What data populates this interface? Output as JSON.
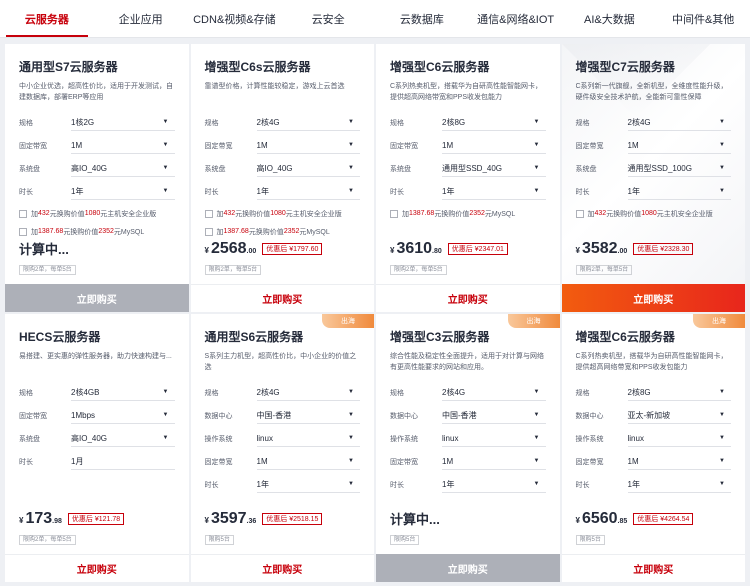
{
  "tabs": [
    {
      "label": "云服务器",
      "active": true
    },
    {
      "label": "企业应用"
    },
    {
      "label": "CDN&视频&存储"
    },
    {
      "label": "云安全"
    },
    {
      "label": "云数据库"
    },
    {
      "label": "通信&网络&IOT"
    },
    {
      "label": "AI&大数据"
    },
    {
      "label": "中间件&其他"
    }
  ],
  "buy_label": "立即购买",
  "colors": {
    "brand": "#c7000b",
    "overseas_tag": "#f08a3c"
  },
  "cards": [
    {
      "title": "通用型S7云服务器",
      "desc": "中小企业优选，超高性价比，适用于开发测试，自建数据库，部署ERP等应用",
      "specs": [
        {
          "label": "规格",
          "value": "1核2G"
        },
        {
          "label": "固定带宽",
          "value": "1M"
        },
        {
          "label": "系统盘",
          "value": "高IO_40G"
        },
        {
          "label": "时长",
          "value": "1年"
        }
      ],
      "options": [
        {
          "pre": "加",
          "a": "432",
          "mid": "元换购价值",
          "b": "1080",
          "post": "元主机安全企业版"
        },
        {
          "pre": "加",
          "a": "1387.68",
          "mid": "元换购价值",
          "b": "2352",
          "post": "元MySQL"
        }
      ],
      "calculating": "计算中...",
      "limit": "限购2单，每单5台",
      "buy_style": "gray"
    },
    {
      "title": "增强型C6s云服务器",
      "desc": "靠谱型价格，计算性能较稳定，游戏上云首选",
      "specs": [
        {
          "label": "规格",
          "value": "2核4G"
        },
        {
          "label": "固定带宽",
          "value": "1M"
        },
        {
          "label": "系统盘",
          "value": "高IO_40G"
        },
        {
          "label": "时长",
          "value": "1年"
        }
      ],
      "options": [
        {
          "pre": "加",
          "a": "432",
          "mid": "元换购价值",
          "b": "1080",
          "post": "元主机安全企业版"
        },
        {
          "pre": "加",
          "a": "1387.68",
          "mid": "元换购价值",
          "b": "2352",
          "post": "元MySQL"
        }
      ],
      "currency": "¥",
      "price_int": "2568",
      "price_dec": ".00",
      "discount": "优惠后 ¥1797.60",
      "limit": "限购2单，每单5台",
      "buy_style": "normal"
    },
    {
      "title": "增强型C6云服务器",
      "desc": "C系列热卖机型，搭载华为自研高性能智能网卡，提供超高网络带宽和PPS收发包能力",
      "specs": [
        {
          "label": "规格",
          "value": "2核8G"
        },
        {
          "label": "固定带宽",
          "value": "1M"
        },
        {
          "label": "系统盘",
          "value": "通用型SSD_40G"
        },
        {
          "label": "时长",
          "value": "1年"
        }
      ],
      "options": [
        {
          "pre": "加",
          "a": "1387.68",
          "mid": "元换购价值",
          "b": "2352",
          "post": "元MySQL"
        }
      ],
      "currency": "¥",
      "price_int": "3610",
      "price_dec": ".80",
      "discount": "优惠后 ¥2347.01",
      "limit": "限购2单，每单5台",
      "buy_style": "normal"
    },
    {
      "title": "增强型C7云服务器",
      "desc": "C系列新一代旗舰，全新机型，全维度性能升级，硬件级安全技术护航，全能新可靠性保障",
      "specs": [
        {
          "label": "规格",
          "value": "2核4G"
        },
        {
          "label": "固定带宽",
          "value": "1M"
        },
        {
          "label": "系统盘",
          "value": "通用型SSD_100G"
        },
        {
          "label": "时长",
          "value": "1年"
        }
      ],
      "options": [
        {
          "pre": "加",
          "a": "432",
          "mid": "元换购价值",
          "b": "1080",
          "post": "元主机安全企业版"
        }
      ],
      "currency": "¥",
      "price_int": "3582",
      "price_dec": ".00",
      "discount": "优惠后 ¥2328.30",
      "limit": "限购2单，每单5台",
      "buy_style": "red",
      "deco": true
    },
    {
      "title": "HECS云服务器",
      "desc": "易搭建、更实惠的弹性服务器，助力快速构建与...",
      "specs": [
        {
          "label": "规格",
          "value": "2核4GB"
        },
        {
          "label": "固定带宽",
          "value": "1Mbps"
        },
        {
          "label": "系统盘",
          "value": "高IO_40G"
        },
        {
          "label": "时长",
          "value": "1月",
          "nocaret": true
        }
      ],
      "options": [],
      "currency": "¥",
      "price_int": "173",
      "price_dec": ".98",
      "discount": "优惠后 ¥121.78",
      "limit": "限购2单，每单5台",
      "buy_style": "normal"
    },
    {
      "title": "通用型S6云服务器",
      "tag": "出海",
      "desc": "S系列主力机型，超高性价比，中小企业的价值之选",
      "specs": [
        {
          "label": "规格",
          "value": "2核4G"
        },
        {
          "label": "数据中心",
          "value": "中国-香港"
        },
        {
          "label": "操作系统",
          "value": "linux"
        },
        {
          "label": "固定带宽",
          "value": "1M"
        },
        {
          "label": "时长",
          "value": "1年"
        }
      ],
      "options": [],
      "currency": "¥",
      "price_int": "3597",
      "price_dec": ".36",
      "discount": "优惠后 ¥2518.15",
      "limit": "限购5台",
      "buy_style": "normal"
    },
    {
      "title": "增强型C3云服务器",
      "tag": "出海",
      "desc": "综合性能及稳定性全面提升，适用于对计算与网络有更高性能要求的网站和应用。",
      "specs": [
        {
          "label": "规格",
          "value": "2核4G"
        },
        {
          "label": "数据中心",
          "value": "中国-香港"
        },
        {
          "label": "操作系统",
          "value": "linux"
        },
        {
          "label": "固定带宽",
          "value": "1M"
        },
        {
          "label": "时长",
          "value": "1年"
        }
      ],
      "options": [],
      "calculating": "计算中...",
      "limit": "限购5台",
      "buy_style": "gray"
    },
    {
      "title": "增强型C6云服务器",
      "tag": "出海",
      "desc": "C系列热卖机型，搭载华为自研高性能智能网卡，提供超高网络带宽和PPS收发包能力",
      "specs": [
        {
          "label": "规格",
          "value": "2核8G"
        },
        {
          "label": "数据中心",
          "value": "亚太-新加坡"
        },
        {
          "label": "操作系统",
          "value": "linux"
        },
        {
          "label": "固定带宽",
          "value": "1M"
        },
        {
          "label": "时长",
          "value": "1年"
        }
      ],
      "options": [],
      "currency": "¥",
      "price_int": "6560",
      "price_dec": ".85",
      "discount": "优惠后 ¥4264.54",
      "limit": "限购5台",
      "buy_style": "normal"
    }
  ]
}
